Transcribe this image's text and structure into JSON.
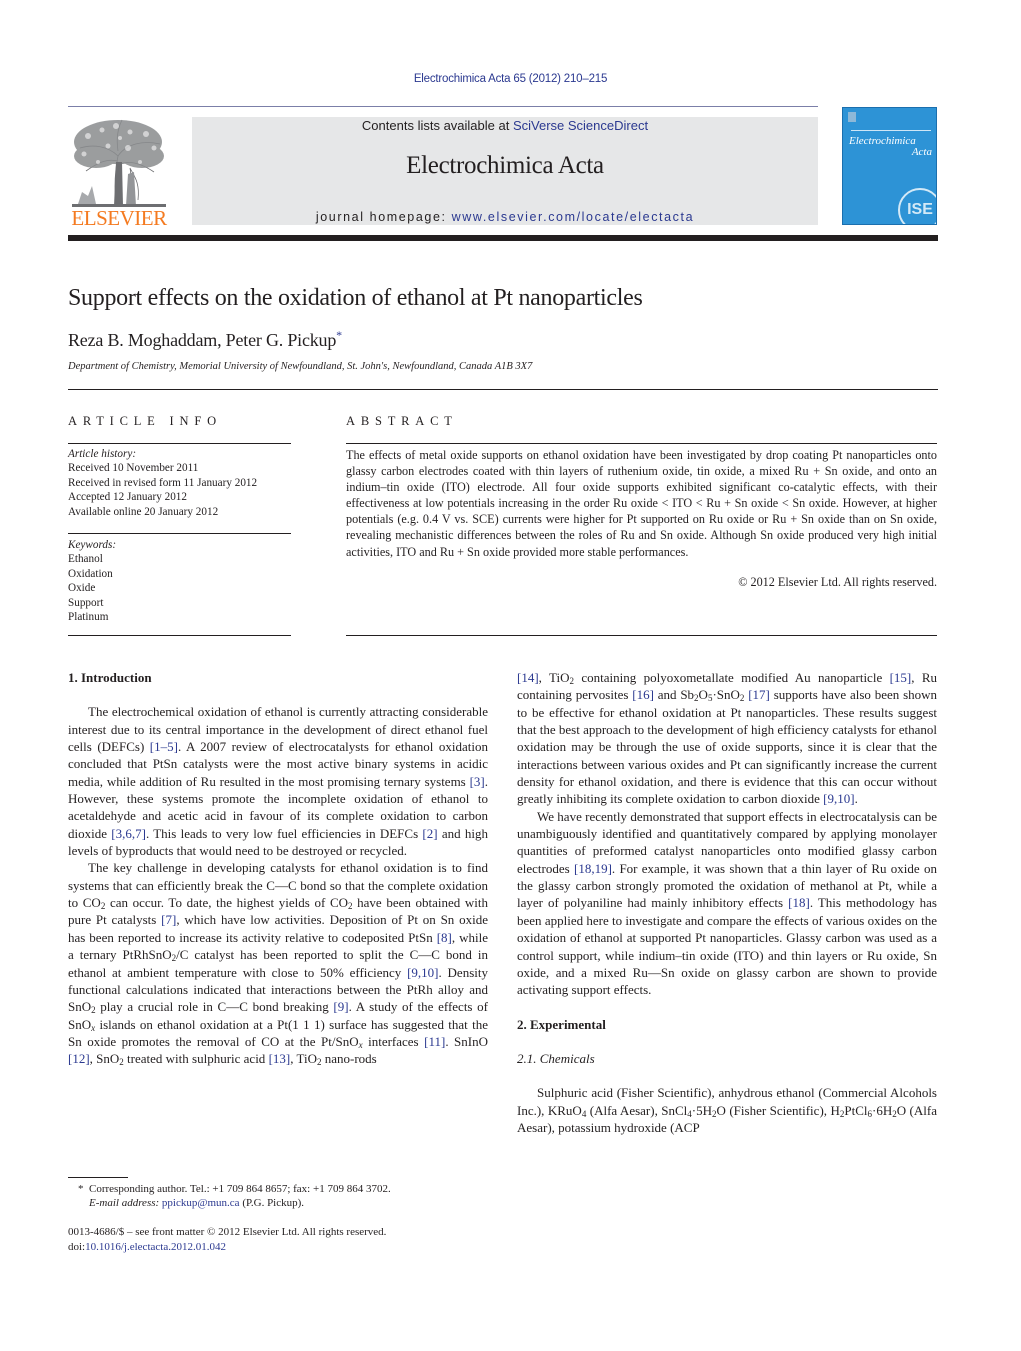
{
  "header": {
    "citation": "Electrochimica Acta 65 (2012) 210–215",
    "contents_prefix": "Contents lists available at ",
    "contents_link": "SciVerse ScienceDirect",
    "journal_name": "Electrochimica Acta",
    "homepage_prefix": "journal homepage: ",
    "homepage_link": "www.elsevier.com/locate/electacta",
    "publisher_logo_text": "ELSEVIER",
    "cover": {
      "title_line1": "Electrochimica",
      "title_line2": "Acta",
      "badge": "ISE",
      "color": "#2d93d6"
    },
    "accent_color": "#f47a20",
    "link_color": "#2b3990"
  },
  "article": {
    "title": "Support effects on the oxidation of ethanol at Pt nanoparticles",
    "authors": "Reza B. Moghaddam, Peter G. Pickup",
    "author_mark": "*",
    "affiliation": "Department of Chemistry, Memorial University of Newfoundland, St. John's, Newfoundland, Canada A1B 3X7"
  },
  "article_info": {
    "heading": "ARTICLE INFO",
    "history_label": "Article history:",
    "history": [
      "Received 10 November 2011",
      "Received in revised form 11 January 2012",
      "Accepted 12 January 2012",
      "Available online 20 January 2012"
    ],
    "keywords_label": "Keywords:",
    "keywords": [
      "Ethanol",
      "Oxidation",
      "Oxide",
      "Support",
      "Platinum"
    ]
  },
  "abstract": {
    "heading": "ABSTRACT",
    "text": "The effects of metal oxide supports on ethanol oxidation have been investigated by drop coating Pt nanoparticles onto glassy carbon electrodes coated with thin layers of ruthenium oxide, tin oxide, a mixed Ru + Sn oxide, and onto an indium–tin oxide (ITO) electrode. All four oxide supports exhibited significant co-catalytic effects, with their effectiveness at low potentials increasing in the order Ru oxide < ITO < Ru + Sn oxide < Sn oxide. However, at higher potentials (e.g. 0.4 V vs. SCE) currents were higher for Pt supported on Ru oxide or Ru + Sn oxide than on Sn oxide, revealing mechanistic differences between the roles of Ru and Sn oxide. Although Sn oxide produced very high initial activities, ITO and Ru + Sn oxide provided more stable performances.",
    "copyright": "© 2012 Elsevier Ltd. All rights reserved."
  },
  "body": {
    "sec1_heading": "1.  Introduction",
    "p1": [
      "The electrochemical oxidation of ethanol is currently attracting considerable interest due to its central importance in the development of direct ethanol fuel cells (DEFCs) ",
      "[1–5]",
      ". A 2007 review of electrocatalysts for ethanol oxidation concluded that PtSn catalysts were the most active binary systems in acidic media, while addition of Ru resulted in the most promising ternary systems ",
      "[3]",
      ". However, these systems promote the incomplete oxidation of ethanol to acetaldehyde and acetic acid in favour of its complete oxidation to carbon dioxide ",
      "[3,6,7]",
      ". This leads to very low fuel efficiencies in DEFCs ",
      "[2]",
      " and high levels of byproducts that would need to be destroyed or recycled."
    ],
    "p2": {
      "t1": "The key challenge in developing catalysts for ethanol oxidation is to find systems that can efficiently break the C—C bond so that the complete oxidation to CO",
      "t2": " can occur. To date, the highest yields of CO",
      "t3": " have been obtained with pure Pt catalysts ",
      "r1": "[7]",
      "t4": ", which have low activities. Deposition of Pt on Sn oxide has been reported to increase its activity relative to codeposited PtSn ",
      "r2": "[8]",
      "t5": ", while a ternary PtRhSnO",
      "t6": "/C catalyst has been reported to split the C—C bond in ethanol at ambient temperature with close to 50% efficiency ",
      "r3": "[9,10]",
      "t7": ". Density functional calculations indicated that interactions between the PtRh alloy and SnO",
      "t8": " play a crucial role in C—C bond breaking ",
      "r4": "[9]",
      "t9": ". A study of the effects of SnO",
      "t10": " islands on ethanol oxidation at a Pt(1 1 1) surface has suggested that the Sn oxide promotes the removal of CO at the Pt/SnO",
      "t11": " interfaces ",
      "r5": "[11]",
      "t12": ". SnInO ",
      "r6": "[12]",
      "t13": ", SnO",
      "t14": " treated with sulphuric acid ",
      "r7": "[13]",
      "t15": ", TiO",
      "t16": " nano-rods ",
      "sub2": "2",
      "subx": "x"
    },
    "p2_cont": {
      "r1": "[14]",
      "t1": ", TiO",
      "t2": " containing polyoxometallate modified Au nanoparticle ",
      "r2": "[15]",
      "t3": ", Ru containing pervosites ",
      "r3": "[16]",
      "t4": " and Sb",
      "t5": "O",
      "t6": "·SnO",
      "t7": " ",
      "r4": "[17]",
      "t8": " supports have also been shown to be effective for ethanol oxidation at Pt nanoparticles. These results suggest that the best approach to the development of high efficiency catalysts for ethanol oxidation may be through the use of oxide supports, since it is clear that the interactions between various oxides and Pt can significantly increase the current density for ethanol oxidation, and there is evidence that this can occur without greatly inhibiting its complete oxidation to carbon dioxide ",
      "r5": "[9,10]",
      "t9": ".",
      "sub2": "2",
      "sub5": "5"
    },
    "p3": {
      "t1": "We have recently demonstrated that support effects in electrocatalysis can be unambiguously identified and quantitatively compared by applying monolayer quantities of preformed catalyst nanoparticles onto modified glassy carbon electrodes ",
      "r1": "[18,19]",
      "t2": ". For example, it was shown that a thin layer of Ru oxide on the glassy carbon strongly promoted the oxidation of methanol at Pt, while a layer of polyaniline had mainly inhibitory effects ",
      "r2": "[18]",
      "t3": ". This methodology has been applied here to investigate and compare the effects of various oxides on the oxidation of ethanol at supported Pt nanoparticles. Glassy carbon was used as a control support, while indium–tin oxide (ITO) and thin layers or Ru oxide, Sn oxide, and a mixed Ru—Sn oxide on glassy carbon are shown to provide activating support effects."
    },
    "sec2_heading": "2.  Experimental",
    "sec21_heading": "2.1.  Chemicals",
    "p4": {
      "t1": "Sulphuric acid (Fisher Scientific), anhydrous ethanol (Commercial Alcohols Inc.), KRuO",
      "s1": "4",
      "t2": " (Alfa Aesar), SnCl",
      "s2": "4",
      "t3": "·5H",
      "s3": "2",
      "t4": "O (Fisher Scientific), H",
      "s4": "2",
      "t5": "PtCl",
      "s5": "6",
      "t6": "·6H",
      "s6": "2",
      "t7": "O (Alfa Aesar), potassium hydroxide (ACP"
    }
  },
  "footnotes": {
    "mark": "*",
    "corresponding": "Corresponding author. Tel.: +1 709 864 8657; fax: +1 709 864 3702.",
    "email_label": "E-mail address: ",
    "email": "ppickup@mun.ca",
    "email_suffix": " (P.G. Pickup).",
    "issn": "0013-4686/$ – see front matter © 2012 Elsevier Ltd. All rights reserved.",
    "doi_prefix": "doi:",
    "doi": "10.1016/j.electacta.2012.01.042"
  }
}
